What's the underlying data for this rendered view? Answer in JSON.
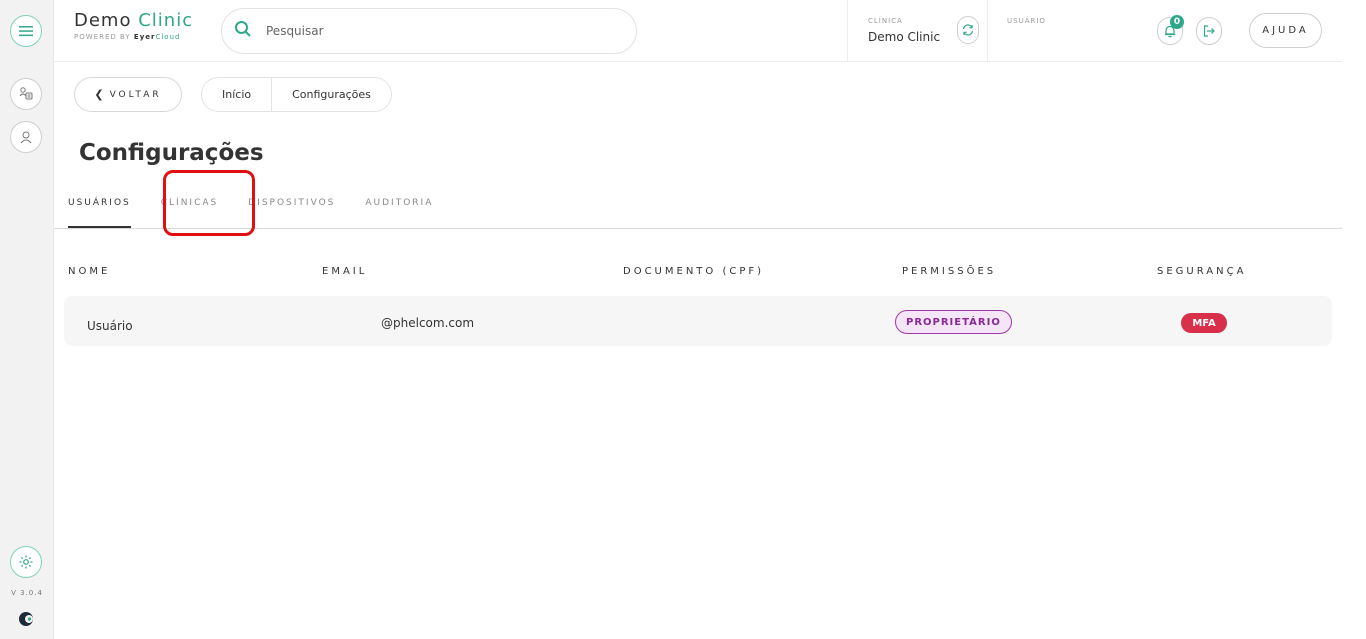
{
  "brand": {
    "name_main": "Demo",
    "name_accent": "Clinic",
    "powered_prefix": "POWERED BY",
    "powered_brand_a": "Eyer",
    "powered_brand_b": "Cloud"
  },
  "search": {
    "placeholder": "Pesquisar"
  },
  "header": {
    "clinic_label": "CLÍNICA",
    "clinic_name": "Demo Clinic",
    "user_label": "USUÁRIO",
    "notifications_count": "0",
    "help_label": "AJUDA"
  },
  "nav": {
    "back_label": "VOLTAR",
    "breadcrumbs": [
      "Início",
      "Configurações"
    ]
  },
  "page": {
    "title": "Configurações"
  },
  "tabs": [
    "USUÁRIOS",
    "CLÍNICAS",
    "DISPOSITIVOS",
    "AUDITORIA"
  ],
  "table": {
    "columns": [
      "NOME",
      "EMAIL",
      "DOCUMENTO (CPF)",
      "PERMISSÕES",
      "SEGURANÇA"
    ],
    "rows": [
      {
        "name": "Usuário",
        "email": "@phelcom.com",
        "document": "",
        "permission": "PROPRIETÁRIO",
        "security": "MFA"
      }
    ]
  },
  "sidebar": {
    "version": "V 3.0.4"
  },
  "icons": {
    "menu": "hamburger-menu-icon",
    "patients": "patients-icon",
    "user": "user-icon",
    "settings": "gear-icon",
    "search": "search-icon",
    "refresh": "refresh-icon",
    "bell": "bell-icon",
    "logout": "logout-icon",
    "back": "chevron-left-icon",
    "logo": "eyercloud-logo-icon"
  },
  "colors": {
    "accent": "#2fa889",
    "owner": "#8b2a96",
    "mfa": "#d8304a",
    "highlight": "#e01010"
  }
}
